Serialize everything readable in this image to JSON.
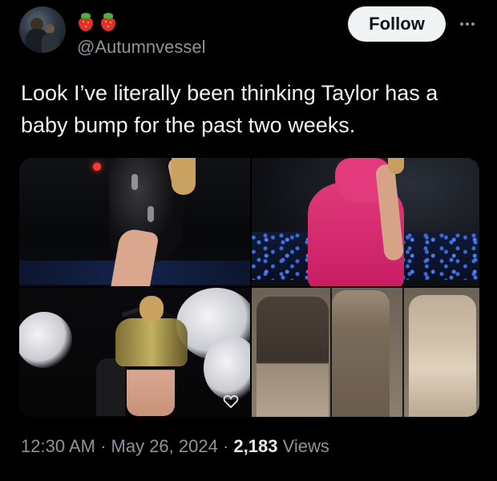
{
  "user": {
    "avatar_icon": "profile-photo",
    "display_name_emojis": [
      "strawberry-icon",
      "strawberry-icon"
    ],
    "handle": "@Autumnvessel"
  },
  "actions": {
    "follow_label": "Follow",
    "more_icon": "ellipsis-icon"
  },
  "tweet": {
    "text": "Look I’ve literally been thinking Taylor has a baby bump for the past two weeks."
  },
  "media": {
    "count": 4,
    "swap_icon": "heart-outline-icon"
  },
  "meta": {
    "time": "12:30 AM",
    "sep1": " · ",
    "date": "May 26, 2024",
    "sep2": " · ",
    "views_count": "2,183",
    "views_label": " Views"
  },
  "colors": {
    "background": "#000000",
    "text": "#e7e9ea",
    "secondary": "#8b949e",
    "follow_bg": "#eff3f4",
    "follow_text": "#0f1419"
  }
}
